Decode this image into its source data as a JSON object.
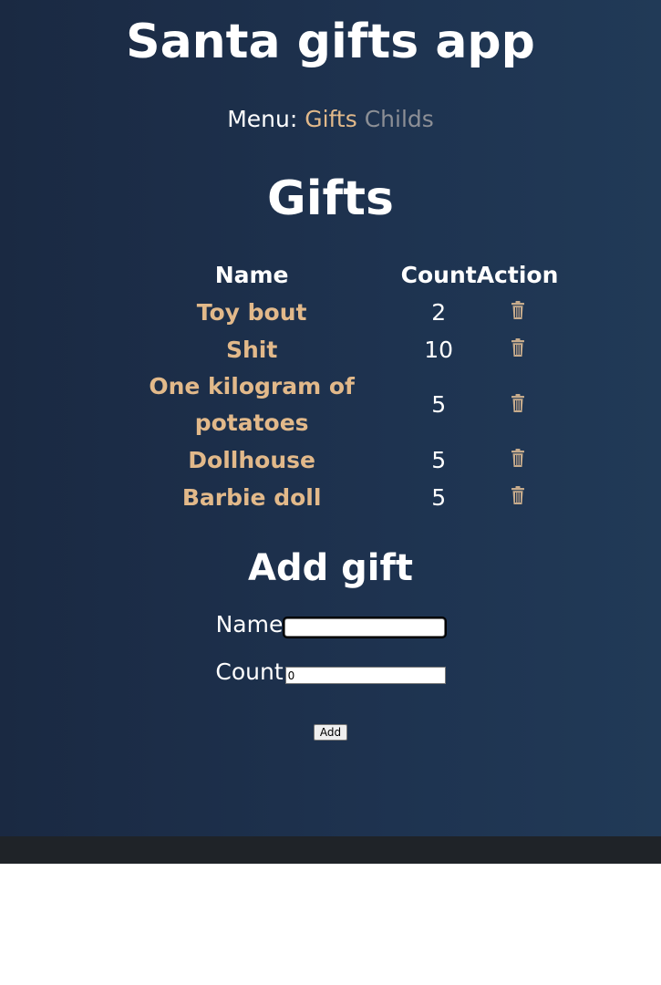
{
  "app": {
    "title": "Santa gifts app"
  },
  "menu": {
    "prefix": "Menu:",
    "items": [
      {
        "label": "Gifts",
        "active": true
      },
      {
        "label": "Childs",
        "active": false
      }
    ]
  },
  "gifts_section": {
    "title": "Gifts",
    "columns": {
      "name": "Name",
      "count": "Count",
      "action": "Action"
    },
    "rows": [
      {
        "name": "Toy bout",
        "count": "2"
      },
      {
        "name": "Shit",
        "count": "10"
      },
      {
        "name": "One kilogram of potatoes",
        "count": "5"
      },
      {
        "name": "Dollhouse",
        "count": "5"
      },
      {
        "name": "Barbie doll",
        "count": "5"
      }
    ],
    "action_icon": "trash-icon"
  },
  "add_form": {
    "title": "Add gift",
    "name_label": "Name",
    "name_value": "",
    "count_label": "Count",
    "count_value": "0",
    "submit_label": "Add"
  },
  "colors": {
    "accent": "#e2b98a",
    "inactive_link": "#8c8f96",
    "background": "#1e3350"
  }
}
